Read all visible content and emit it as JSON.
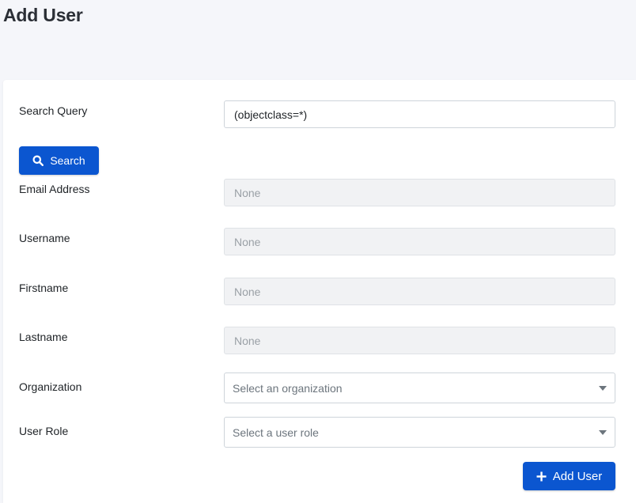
{
  "page": {
    "title": "Add User"
  },
  "form": {
    "search_query": {
      "label": "Search Query",
      "value": "(objectclass=*)"
    },
    "search_button": {
      "label": "Search",
      "icon": "search-icon"
    },
    "email": {
      "label": "Email Address",
      "value": "None"
    },
    "username": {
      "label": "Username",
      "value": "None"
    },
    "firstname": {
      "label": "Firstname",
      "value": "None"
    },
    "lastname": {
      "label": "Lastname",
      "value": "None"
    },
    "organization": {
      "label": "Organization",
      "placeholder": "Select an organization"
    },
    "user_role": {
      "label": "User Role",
      "placeholder": "Select a user role"
    },
    "add_button": {
      "label": "Add User",
      "icon": "plus-icon"
    }
  },
  "colors": {
    "primary": "#0b56d0",
    "background": "#f5f6fa",
    "card": "#ffffff",
    "disabled_field": "#f1f2f4"
  }
}
